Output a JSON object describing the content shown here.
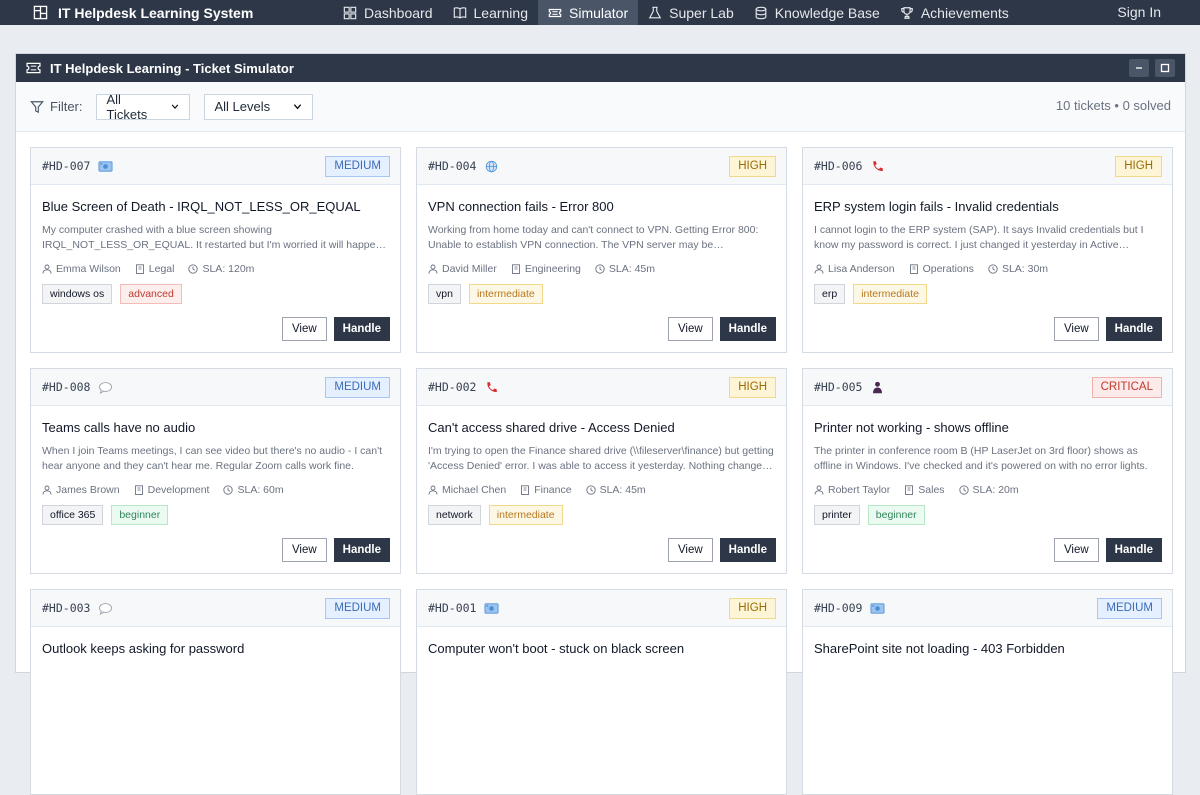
{
  "app": {
    "title": "IT Helpdesk Learning System",
    "nav": [
      {
        "label": "Dashboard",
        "icon": "dashboard-icon"
      },
      {
        "label": "Learning",
        "icon": "book-icon"
      },
      {
        "label": "Simulator",
        "icon": "ticket-icon",
        "active": true
      },
      {
        "label": "Super Lab",
        "icon": "flask-icon"
      },
      {
        "label": "Knowledge Base",
        "icon": "database-icon"
      },
      {
        "label": "Achievements",
        "icon": "trophy-icon"
      }
    ],
    "signin": "Sign In"
  },
  "window": {
    "title": "IT Helpdesk Learning - Ticket Simulator"
  },
  "toolbar": {
    "filter_label": "Filter:",
    "ticket_filter": "All Tickets",
    "level_filter": "All Levels",
    "count_text": "10 tickets • 0 solved"
  },
  "buttons": {
    "view": "View",
    "handle": "Handle"
  },
  "colors": {
    "dark": "#2d3748",
    "medium": "#3b6cb7",
    "high": "#9a6b06",
    "critical": "#c0392b"
  },
  "tickets": [
    {
      "id": "#HD-007",
      "channel": "email-icon",
      "priority": "MEDIUM",
      "title": "Blue Screen of Death - IRQL_NOT_LESS_OR_EQUAL",
      "desc": "My computer crashed with a blue screen showing IRQL_NOT_LESS_OR_EQUAL. It restarted but I'm worried it will happen again.",
      "user": "Emma Wilson",
      "dept": "Legal",
      "sla": "SLA: 120m",
      "category": "windows os",
      "level": "advanced"
    },
    {
      "id": "#HD-004",
      "channel": "globe-icon",
      "priority": "HIGH",
      "title": "VPN connection fails - Error 800",
      "desc": "Working from home today and can't connect to VPN. Getting Error 800: Unable to establish VPN connection. The VPN server may be unreachable.",
      "user": "David Miller",
      "dept": "Engineering",
      "sla": "SLA: 45m",
      "category": "vpn",
      "level": "intermediate"
    },
    {
      "id": "#HD-006",
      "channel": "phone-icon",
      "priority": "HIGH",
      "title": "ERP system login fails - Invalid credentials",
      "desc": "I cannot login to the ERP system (SAP). It says Invalid credentials but I know my password is correct. I just changed it yesterday in Active Directory.",
      "user": "Lisa Anderson",
      "dept": "Operations",
      "sla": "SLA: 30m",
      "category": "erp",
      "level": "intermediate"
    },
    {
      "id": "#HD-008",
      "channel": "chat-icon",
      "priority": "MEDIUM",
      "title": "Teams calls have no audio",
      "desc": "When I join Teams meetings, I can see video but there's no audio - I can't hear anyone and they can't hear me. Regular Zoom calls work fine.",
      "user": "James Brown",
      "dept": "Development",
      "sla": "SLA: 60m",
      "category": "office 365",
      "level": "beginner"
    },
    {
      "id": "#HD-002",
      "channel": "phone-icon",
      "priority": "HIGH",
      "title": "Can't access shared drive - Access Denied",
      "desc": "I'm trying to open the Finance shared drive (\\\\fileserver\\finance) but getting 'Access Denied' error. I was able to access it yesterday. Nothing changed on my end.",
      "user": "Michael Chen",
      "dept": "Finance",
      "sla": "SLA: 45m",
      "category": "network",
      "level": "intermediate"
    },
    {
      "id": "#HD-005",
      "channel": "walkin-icon",
      "priority": "CRITICAL",
      "title": "Printer not working - shows offline",
      "desc": "The printer in conference room B (HP LaserJet on 3rd floor) shows as offline in Windows. I've checked and it's powered on with no error lights.",
      "user": "Robert Taylor",
      "dept": "Sales",
      "sla": "SLA: 20m",
      "category": "printer",
      "level": "beginner"
    },
    {
      "id": "#HD-003",
      "channel": "chat-icon",
      "priority": "MEDIUM",
      "title": "Outlook keeps asking for password",
      "desc": "",
      "user": "",
      "dept": "",
      "sla": "",
      "category": "",
      "level": ""
    },
    {
      "id": "#HD-001",
      "channel": "email-icon",
      "priority": "HIGH",
      "title": "Computer won't boot - stuck on black screen",
      "desc": "",
      "user": "",
      "dept": "",
      "sla": "",
      "category": "",
      "level": ""
    },
    {
      "id": "#HD-009",
      "channel": "email-icon",
      "priority": "MEDIUM",
      "title": "SharePoint site not loading - 403 Forbidden",
      "desc": "",
      "user": "",
      "dept": "",
      "sla": "",
      "category": "",
      "level": ""
    }
  ]
}
